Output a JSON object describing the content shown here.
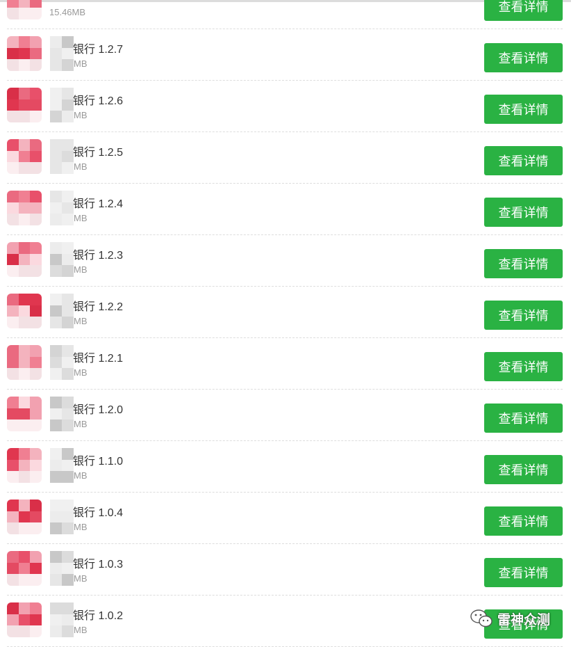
{
  "list": {
    "items": [
      {
        "title": "",
        "size": "15.46MB",
        "button": "查看详情"
      },
      {
        "title": "银行 1.2.7",
        "size": "MB",
        "button": "查看详情"
      },
      {
        "title": "银行 1.2.6",
        "size": "MB",
        "button": "查看详情"
      },
      {
        "title": "银行 1.2.5",
        "size": "MB",
        "button": "查看详情"
      },
      {
        "title": "银行 1.2.4",
        "size": "MB",
        "button": "查看详情"
      },
      {
        "title": "银行 1.2.3",
        "size": "MB",
        "button": "查看详情"
      },
      {
        "title": "银行 1.2.2",
        "size": "MB",
        "button": "查看详情"
      },
      {
        "title": "银行 1.2.1",
        "size": "MB",
        "button": "查看详情"
      },
      {
        "title": "银行 1.2.0",
        "size": "MB",
        "button": "查看详情"
      },
      {
        "title": "银行 1.1.0",
        "size": "MB",
        "button": "查看详情"
      },
      {
        "title": "银行 1.0.4",
        "size": "MB",
        "button": "查看详情"
      },
      {
        "title": "银行 1.0.3",
        "size": "MB",
        "button": "查看详情"
      },
      {
        "title": "银行 1.0.2",
        "size": "MB",
        "button": "查看详情"
      }
    ]
  },
  "watermark": {
    "text": "雷神众测",
    "icon": "wechat-icon"
  },
  "colors": {
    "button": "#2ab243",
    "icon_red": "#e0364f"
  }
}
